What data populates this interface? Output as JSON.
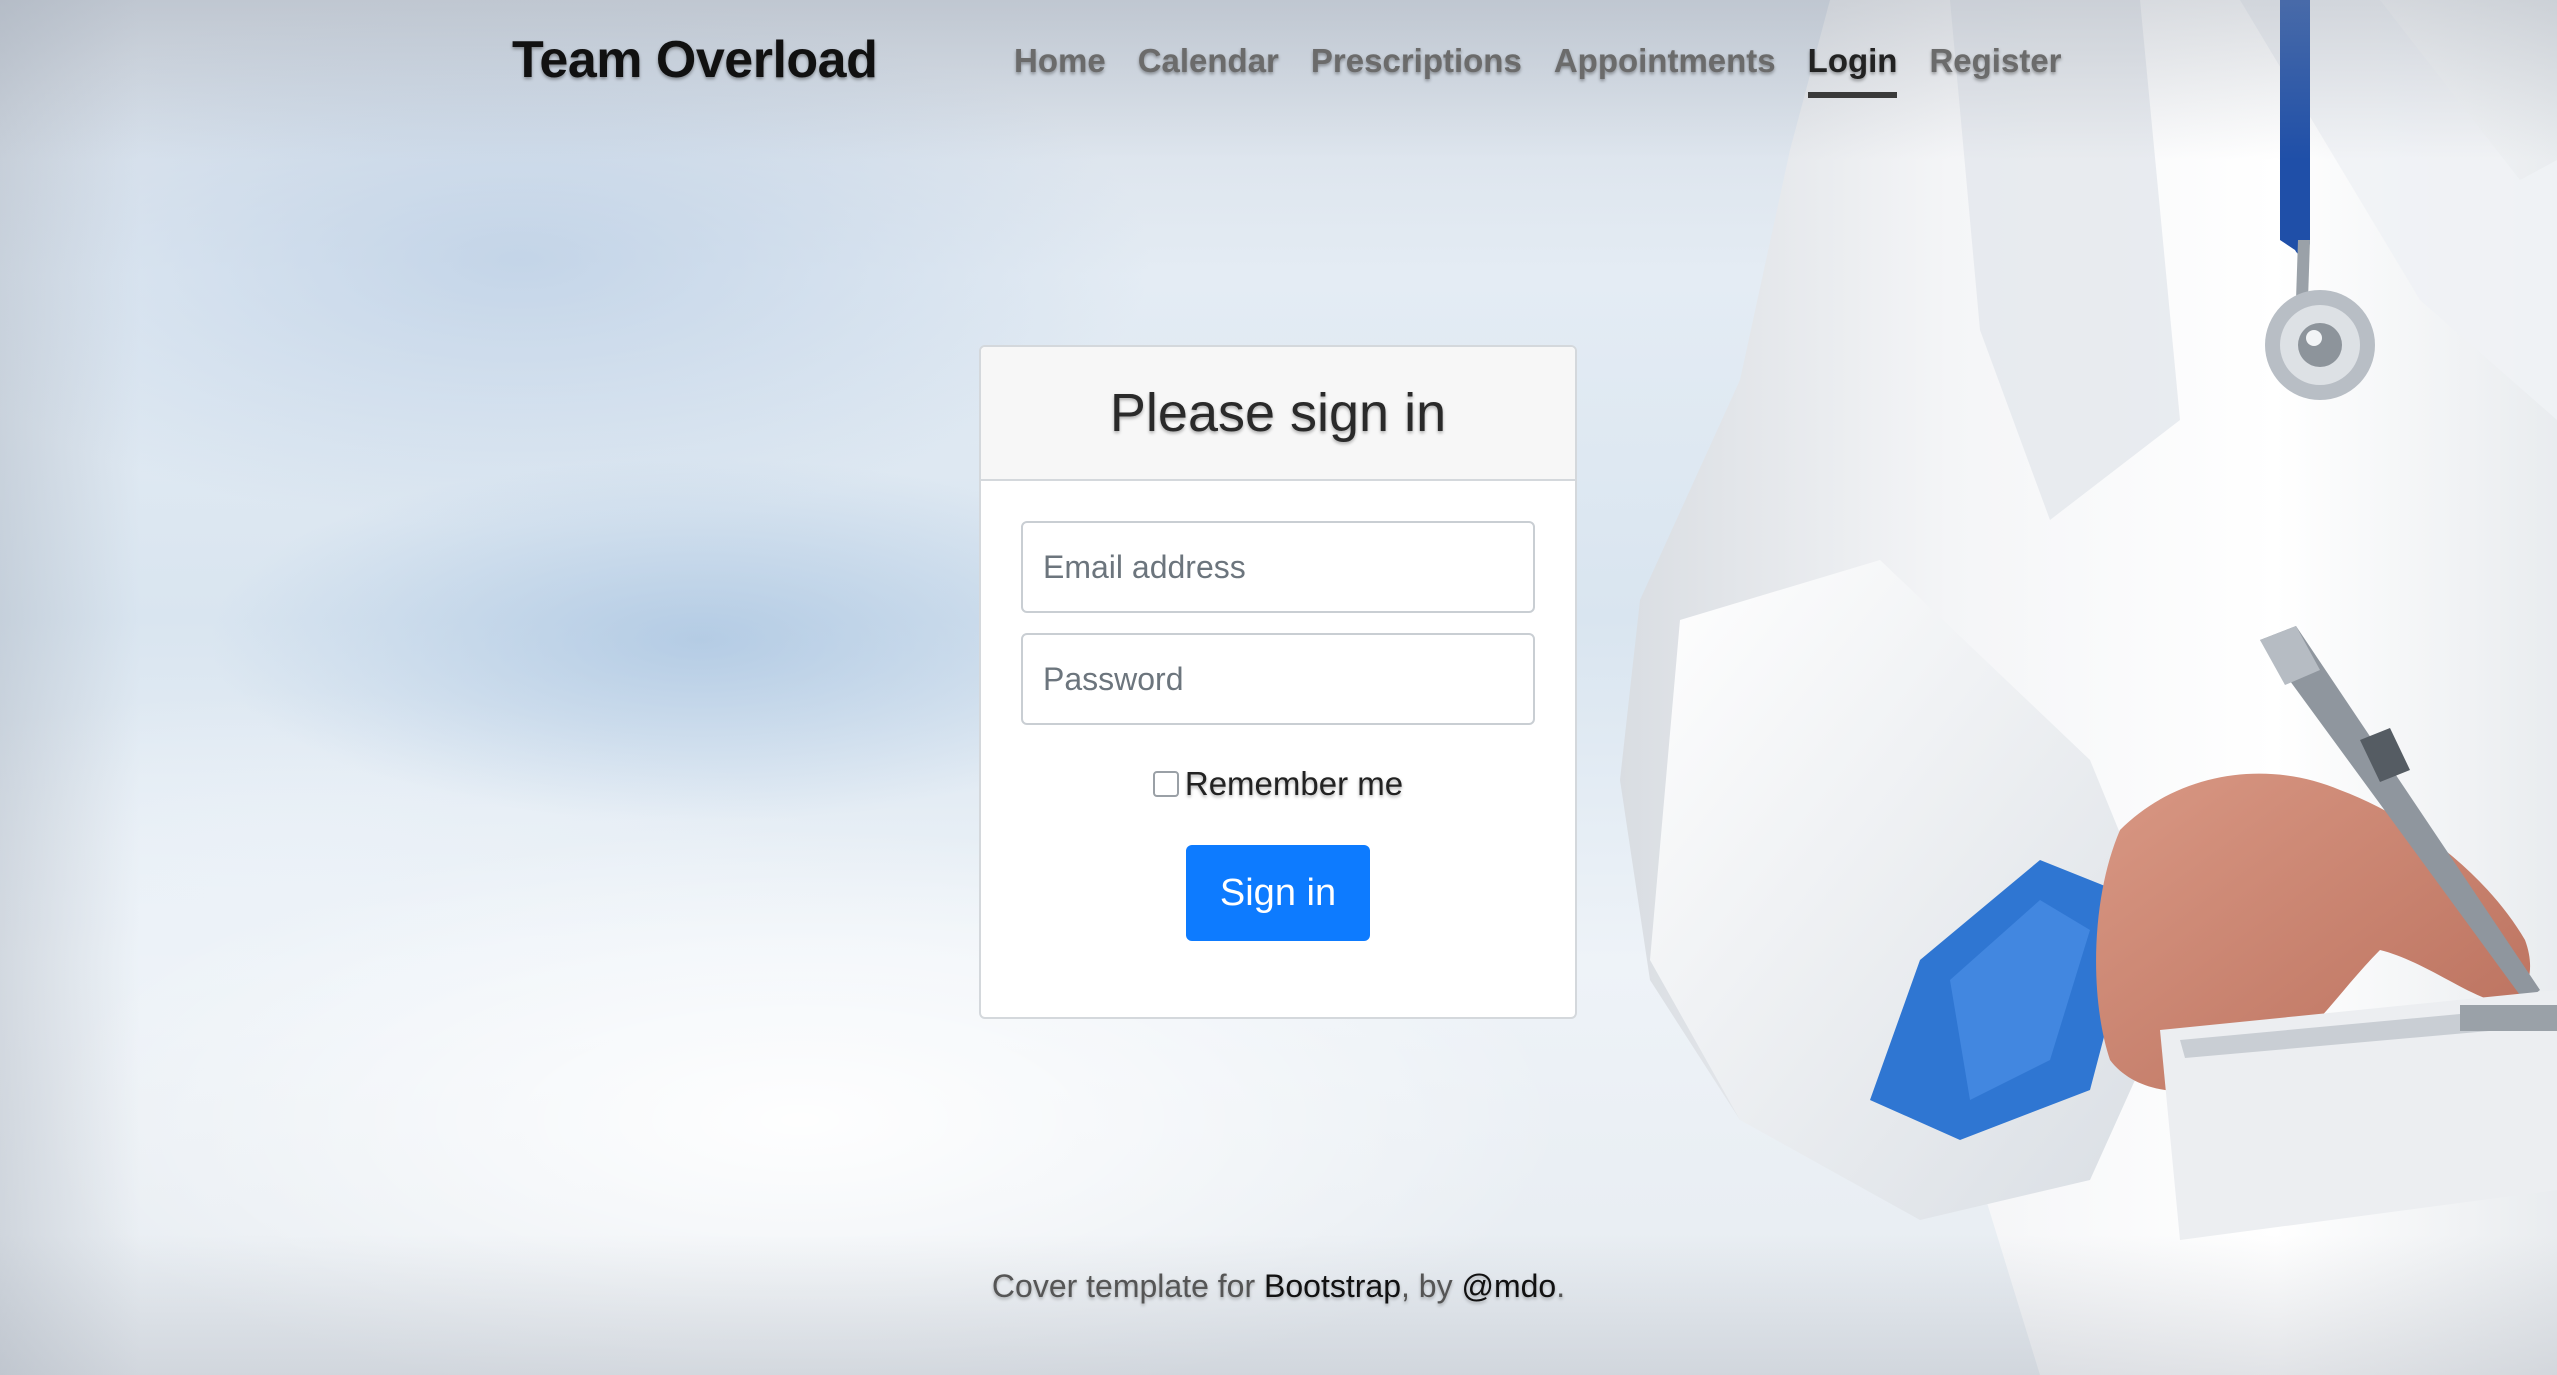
{
  "header": {
    "brand": "Team Overload",
    "nav": [
      {
        "label": "Home",
        "active": false
      },
      {
        "label": "Calendar",
        "active": false
      },
      {
        "label": "Prescriptions",
        "active": false
      },
      {
        "label": "Appointments",
        "active": false
      },
      {
        "label": "Login",
        "active": true
      },
      {
        "label": "Register",
        "active": false
      }
    ]
  },
  "login": {
    "title": "Please sign in",
    "email_placeholder": "Email address",
    "password_placeholder": "Password",
    "remember_label": "Remember me",
    "remember_checked": false,
    "submit_label": "Sign in"
  },
  "footer": {
    "prefix": "Cover template for ",
    "link1": "Bootstrap",
    "middle": ", by ",
    "link2": "@mdo",
    "suffix": "."
  },
  "colors": {
    "primary_button": "#0d7bff",
    "active_nav_underline": "#3a3a3a"
  }
}
